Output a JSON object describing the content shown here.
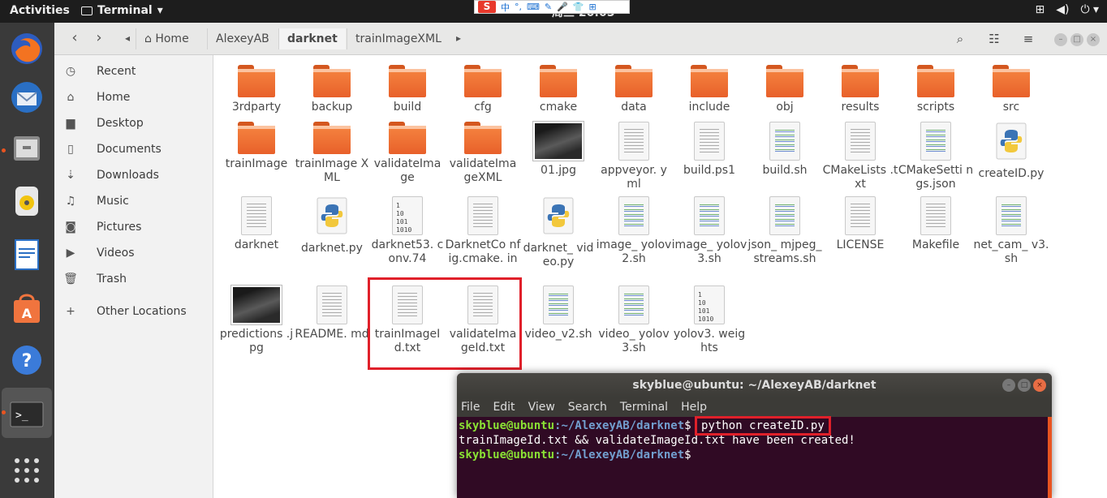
{
  "topbar": {
    "activities": "Activities",
    "app_name": "Terminal",
    "clock": "周三 20:05"
  },
  "ime": {
    "logo": "S",
    "items": [
      "中",
      "°,",
      "⌨",
      "✎",
      "🎤",
      "👕",
      "⊞"
    ]
  },
  "files": {
    "breadcrumbs": [
      "Home",
      "AlexeyAB",
      "darknet",
      "trainImageXML"
    ],
    "active_crumb": "darknet",
    "sidebar": [
      {
        "icon": "clock-icon",
        "label": "Recent"
      },
      {
        "icon": "home-icon",
        "label": "Home"
      },
      {
        "icon": "desktop-icon",
        "label": "Desktop"
      },
      {
        "icon": "document-icon",
        "label": "Documents"
      },
      {
        "icon": "download-icon",
        "label": "Downloads"
      },
      {
        "icon": "music-icon",
        "label": "Music"
      },
      {
        "icon": "camera-icon",
        "label": "Pictures"
      },
      {
        "icon": "video-icon",
        "label": "Videos"
      },
      {
        "icon": "trash-icon",
        "label": "Trash"
      },
      {
        "icon": "plus-icon",
        "label": "Other Locations"
      }
    ],
    "items": [
      {
        "name": "3rdparty",
        "type": "folder"
      },
      {
        "name": "backup",
        "type": "folder"
      },
      {
        "name": "build",
        "type": "folder"
      },
      {
        "name": "cfg",
        "type": "folder"
      },
      {
        "name": "cmake",
        "type": "folder"
      },
      {
        "name": "data",
        "type": "folder"
      },
      {
        "name": "include",
        "type": "folder"
      },
      {
        "name": "obj",
        "type": "folder"
      },
      {
        "name": "results",
        "type": "folder"
      },
      {
        "name": "scripts",
        "type": "folder"
      },
      {
        "name": "src",
        "type": "folder"
      },
      {
        "name": "trainImage",
        "type": "folder"
      },
      {
        "name": "trainImage XML",
        "type": "folder"
      },
      {
        "name": "validateIma ge",
        "type": "folder"
      },
      {
        "name": "validateIma geXML",
        "type": "folder"
      },
      {
        "name": "01.jpg",
        "type": "image"
      },
      {
        "name": "appveyor. yml",
        "type": "text"
      },
      {
        "name": "build.ps1",
        "type": "text"
      },
      {
        "name": "build.sh",
        "type": "script"
      },
      {
        "name": "CMakeLists .txt",
        "type": "text"
      },
      {
        "name": "CMakeSetti ngs.json",
        "type": "script"
      },
      {
        "name": "createID.py",
        "type": "python"
      },
      {
        "name": "darknet",
        "type": "text"
      },
      {
        "name": "darknet.py",
        "type": "python"
      },
      {
        "name": "darknet53. conv.74",
        "type": "binary"
      },
      {
        "name": "DarknetCo nfig.cmake. in",
        "type": "text"
      },
      {
        "name": "darknet_ video.py",
        "type": "python"
      },
      {
        "name": "image_ yolov2.sh",
        "type": "script"
      },
      {
        "name": "image_ yolov3.sh",
        "type": "script"
      },
      {
        "name": "json_ mjpeg_ streams.sh",
        "type": "script"
      },
      {
        "name": "LICENSE",
        "type": "text"
      },
      {
        "name": "Makefile",
        "type": "text"
      },
      {
        "name": "net_cam_ v3.sh",
        "type": "script"
      },
      {
        "name": "predictions .jpg",
        "type": "image"
      },
      {
        "name": "README. md",
        "type": "text"
      },
      {
        "name": "trainImageI d.txt",
        "type": "text"
      },
      {
        "name": "validateIma geId.txt",
        "type": "text"
      },
      {
        "name": "video_v2.sh",
        "type": "script"
      },
      {
        "name": "video_ yolov3.sh",
        "type": "script"
      },
      {
        "name": "yolov3. weights",
        "type": "binary"
      }
    ],
    "binary_glyph": [
      "1",
      "10",
      "101",
      "1010"
    ]
  },
  "terminal": {
    "title": "skyblue@ubuntu: ~/AlexeyAB/darknet",
    "menu": [
      "File",
      "Edit",
      "View",
      "Search",
      "Terminal",
      "Help"
    ],
    "prompt_user": "skyblue@ubuntu",
    "prompt_path": ":~/AlexeyAB/darknet",
    "prompt_symbol": "$",
    "command": "python createID.py",
    "output": "trainImageId.txt && validateImageId.txt have been created!",
    "colors": {
      "background": "#300a24",
      "user": "#8ae234",
      "path": "#729fcf"
    }
  },
  "highlight_color": "#e0202a"
}
